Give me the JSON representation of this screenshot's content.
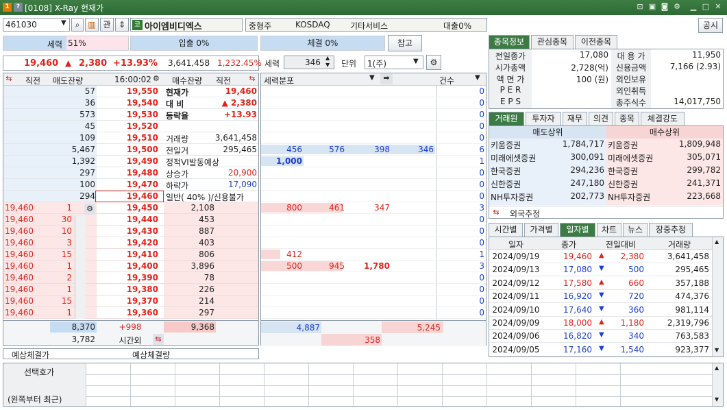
{
  "window": {
    "badge1": "1",
    "badge2": "?",
    "title": "[0108] X-Ray 현재가"
  },
  "top": {
    "code": "461030",
    "stock_name": "아이엠비디엑스",
    "gwan": "관",
    "market1": "중형주",
    "market2": "KOSDAQ",
    "sector": "기타서비스",
    "loan": "대출0%",
    "notice": "공시",
    "kospi_badge": "코"
  },
  "bars": {
    "seryeok": "세력",
    "seryeok_pct": "51%",
    "ipchul": "입출 0%",
    "chegyeol": "체결 0%",
    "ref": "참고"
  },
  "price": {
    "current": "19,460",
    "arrow": "▲",
    "change": "2,380",
    "rate": "+13.93%",
    "volume": "3,641,458",
    "vol_pct": "1,232.45%"
  },
  "ctrl": {
    "seryeok_label": "세력",
    "seryeok_val": "346",
    "unit_label": "단위",
    "unit_val": "1(주)"
  },
  "ob_header": {
    "jikjeon1": "직전",
    "sell_rem": "매도잔량",
    "time": "16:00:02",
    "buy_rem": "매수잔량",
    "jikjeon2": "직전"
  },
  "asks": [
    {
      "prev": "",
      "qty": "57",
      "price": "19,550"
    },
    {
      "prev": "",
      "qty": "36",
      "price": "19,540"
    },
    {
      "prev": "",
      "qty": "573",
      "price": "19,530"
    },
    {
      "prev": "",
      "qty": "45",
      "price": "19,520"
    },
    {
      "prev": "",
      "qty": "109",
      "price": "19,510"
    },
    {
      "prev": "",
      "qty": "5,467",
      "price": "19,500"
    },
    {
      "prev": "",
      "qty": "1,392",
      "price": "19,490"
    },
    {
      "prev": "",
      "qty": "297",
      "price": "19,480"
    },
    {
      "prev": "",
      "qty": "100",
      "price": "19,470"
    },
    {
      "prev": "",
      "qty": "294",
      "price": "19,460"
    }
  ],
  "info_right": [
    {
      "l": "현재가",
      "v": "19,460",
      "cls": "red"
    },
    {
      "l": "대 비",
      "v": "▲ 2,380",
      "cls": "red"
    },
    {
      "l": "등락율",
      "v": "+13.93",
      "cls": "red"
    },
    {
      "l": "",
      "v": "",
      "cls": ""
    },
    {
      "l": "거래량",
      "v": "3,641,458",
      "cls": ""
    },
    {
      "l": "전일거",
      "v": "295,465",
      "cls": ""
    },
    {
      "l": "정적VI발동예상",
      "v": "",
      "cls": ""
    },
    {
      "l": "상승가",
      "v": "20,900",
      "cls": "red"
    },
    {
      "l": "하락가",
      "v": "17,090",
      "cls": "blue"
    },
    {
      "l": "일반( 40% )/신용불가",
      "v": "",
      "cls": ""
    }
  ],
  "bids": [
    {
      "price_l": "19,460",
      "qty_l": "1",
      "price": "19,450",
      "qty": "2,108"
    },
    {
      "price_l": "19,460",
      "qty_l": "30",
      "price": "19,440",
      "qty": "453"
    },
    {
      "price_l": "19,460",
      "qty_l": "10",
      "price": "19,430",
      "qty": "887"
    },
    {
      "price_l": "19,460",
      "qty_l": "3",
      "price": "19,420",
      "qty": "403"
    },
    {
      "price_l": "19,460",
      "qty_l": "15",
      "price": "19,410",
      "qty": "806"
    },
    {
      "price_l": "19,460",
      "qty_l": "1",
      "price": "19,400",
      "qty": "3,896"
    },
    {
      "price_l": "19,460",
      "qty_l": "2",
      "price": "19,390",
      "qty": "78"
    },
    {
      "price_l": "19,460",
      "qty_l": "1",
      "price": "19,380",
      "qty": "226"
    },
    {
      "price_l": "19,460",
      "qty_l": "15",
      "price": "19,370",
      "qty": "214"
    },
    {
      "price_l": "19,460",
      "qty_l": "1",
      "price": "19,360",
      "qty": "297"
    }
  ],
  "ob_total": {
    "sell": "8,370",
    "diff": "+998",
    "buy": "9,368",
    "after_sell": "3,782",
    "after_label": "시간외"
  },
  "expect": {
    "label1": "예상체결가",
    "label2": "예상체결량"
  },
  "dist": {
    "header": "세력분포",
    "count": "건수",
    "ask_rows": [
      [
        "",
        "",
        "",
        "",
        "0"
      ],
      [
        "",
        "",
        "",
        "",
        "0"
      ],
      [
        "",
        "",
        "",
        "",
        "0"
      ],
      [
        "",
        "",
        "",
        "",
        "0"
      ],
      [
        "",
        "",
        "",
        "",
        "0"
      ],
      [
        "456",
        "576",
        "398",
        "346",
        "6"
      ],
      [
        "1,000",
        "",
        "",
        "",
        "1"
      ],
      [
        "",
        "",
        "",
        "",
        "0"
      ],
      [
        "",
        "",
        "",
        "",
        "0"
      ],
      [
        "",
        "",
        "",
        "",
        "0"
      ]
    ],
    "bid_rows": [
      [
        "800",
        "461",
        "347",
        "",
        "3"
      ],
      [
        "",
        "",
        "",
        "",
        "0"
      ],
      [
        "",
        "",
        "",
        "",
        "0"
      ],
      [
        "",
        "",
        "",
        "",
        "0"
      ],
      [
        "412",
        "",
        "",
        "",
        "1"
      ],
      [
        "500",
        "945",
        "1,780",
        "",
        "3"
      ],
      [
        "",
        "",
        "",
        "",
        "0"
      ],
      [
        "",
        "",
        "",
        "",
        "0"
      ],
      [
        "",
        "",
        "",
        "",
        "0"
      ],
      [
        "",
        "",
        "",
        "",
        "0"
      ]
    ],
    "total_l": "4,887",
    "total_r": "5,245",
    "total_mid": "358"
  },
  "info_tabs": [
    "종목정보",
    "관심종목",
    "이전종목"
  ],
  "info": [
    {
      "l1": "전일종가",
      "v1": "17,080",
      "l2": "대 용 가",
      "v2": "11,950"
    },
    {
      "l1": "시가총액",
      "v1": "2,728(억)",
      "l2": "신용금액",
      "v2": "7,166  (2.93)"
    },
    {
      "l1": "액 면 가",
      "v1": "100 (원)",
      "l2": "외인보유",
      "v2": ""
    },
    {
      "l1": "P E R",
      "v1": "",
      "l2": "외인취득",
      "v2": ""
    },
    {
      "l1": "E P S",
      "v1": "",
      "l2": "총주식수",
      "v2": "14,017,750"
    }
  ],
  "broker_tabs": [
    "거래원",
    "투자자",
    "재무",
    "의견",
    "종목",
    "체결강도"
  ],
  "broker": {
    "sell_title": "매도상위",
    "buy_title": "매수상위",
    "foreign": "외국추정",
    "rows": [
      {
        "s": "키움증권",
        "sv": "1,784,717",
        "b": "키움증권",
        "bv": "1,809,948"
      },
      {
        "s": "미래에셋증권",
        "sv": "300,091",
        "b": "미래에셋증권",
        "bv": "305,071"
      },
      {
        "s": "한국증권",
        "sv": "294,236",
        "b": "한국증권",
        "bv": "299,782"
      },
      {
        "s": "신한증권",
        "sv": "247,180",
        "b": "신한증권",
        "bv": "241,371"
      },
      {
        "s": "NH투자증권",
        "sv": "202,773",
        "b": "NH투자증권",
        "bv": "223,668"
      }
    ]
  },
  "daily_tabs": [
    "시간별",
    "가격별",
    "일자별",
    "차트",
    "뉴스",
    "장중추정"
  ],
  "daily_head": [
    "일자",
    "종가",
    "전일대비",
    "거래량"
  ],
  "daily": [
    {
      "d": "2024/09/19",
      "p": "19,460",
      "a": "▲",
      "ch": "2,380",
      "v": "3,641,458",
      "up": true
    },
    {
      "d": "2024/09/13",
      "p": "17,080",
      "a": "▼",
      "ch": "500",
      "v": "295,465",
      "up": false
    },
    {
      "d": "2024/09/12",
      "p": "17,580",
      "a": "▲",
      "ch": "660",
      "v": "357,188",
      "up": true
    },
    {
      "d": "2024/09/11",
      "p": "16,920",
      "a": "▼",
      "ch": "720",
      "v": "474,376",
      "up": false
    },
    {
      "d": "2024/09/10",
      "p": "17,640",
      "a": "▼",
      "ch": "360",
      "v": "981,114",
      "up": false
    },
    {
      "d": "2024/09/09",
      "p": "18,000",
      "a": "▲",
      "ch": "1,180",
      "v": "2,319,796",
      "up": true
    },
    {
      "d": "2024/09/06",
      "p": "16,820",
      "a": "▼",
      "ch": "340",
      "v": "763,583",
      "up": false
    },
    {
      "d": "2024/09/05",
      "p": "17,160",
      "a": "▼",
      "ch": "1,540",
      "v": "923,377",
      "up": false
    }
  ],
  "bottom": {
    "label1": "선택호가",
    "label2": "(왼쪽부터 최근)"
  }
}
